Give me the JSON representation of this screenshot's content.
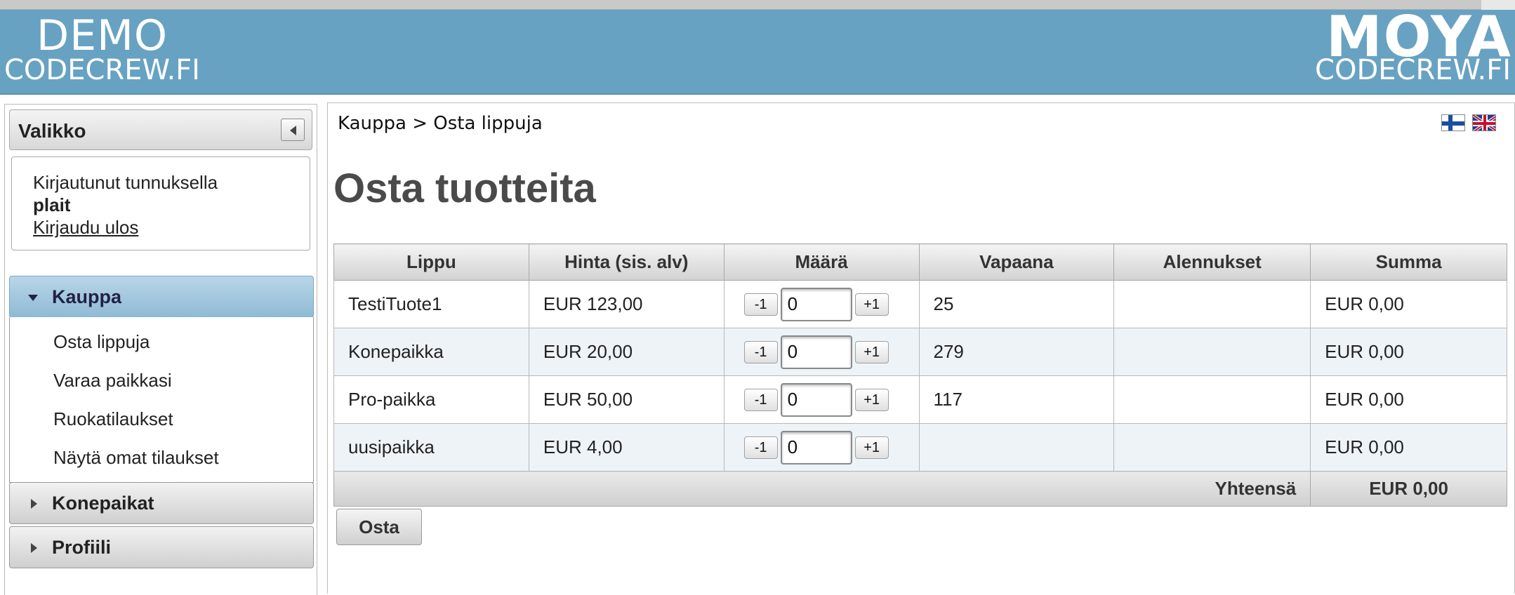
{
  "header": {
    "left_title": "DEMO",
    "left_subtitle": "CODECREW.FI",
    "right_title": "MOYA",
    "right_subtitle": "CODECREW.FI",
    "bg_color": "#68a2c2"
  },
  "sidebar": {
    "title": "Valikko",
    "login": {
      "text": "Kirjautunut tunnuksella",
      "username": "plait",
      "logout": "Kirjaudu ulos"
    },
    "sections": [
      {
        "label": "Kauppa",
        "expanded": true,
        "items": [
          "Osta lippuja",
          "Varaa paikkasi",
          "Ruokatilaukset",
          "Näytä omat tilaukset"
        ]
      },
      {
        "label": "Konepaikat",
        "expanded": false
      },
      {
        "label": "Profiili",
        "expanded": false
      }
    ]
  },
  "main": {
    "breadcrumb": "Kauppa > Osta lippuja",
    "languages": [
      "fi-flag-icon",
      "gb-flag-icon"
    ],
    "title": "Osta tuotteita",
    "columns": [
      "Lippu",
      "Hinta (sis. alv)",
      "Määrä",
      "Vapaana",
      "Alennukset",
      "Summa"
    ],
    "rows": [
      {
        "name": "TestiTuote1",
        "price": "EUR 123,00",
        "qty": "0",
        "available": "25",
        "discounts": "",
        "sum": "EUR 0,00"
      },
      {
        "name": "Konepaikka",
        "price": "EUR 20,00",
        "qty": "0",
        "available": "279",
        "discounts": "",
        "sum": "EUR 0,00"
      },
      {
        "name": "Pro-paikka",
        "price": "EUR 50,00",
        "qty": "0",
        "available": "117",
        "discounts": "",
        "sum": "EUR 0,00"
      },
      {
        "name": "uusipaikka",
        "price": "EUR 4,00",
        "qty": "0",
        "available": "",
        "discounts": "",
        "sum": "EUR 0,00"
      }
    ],
    "minus_label": "-1",
    "plus_label": "+1",
    "total_label": "Yhteensä",
    "total_value": "EUR 0,00",
    "buy_button": "Osta"
  }
}
